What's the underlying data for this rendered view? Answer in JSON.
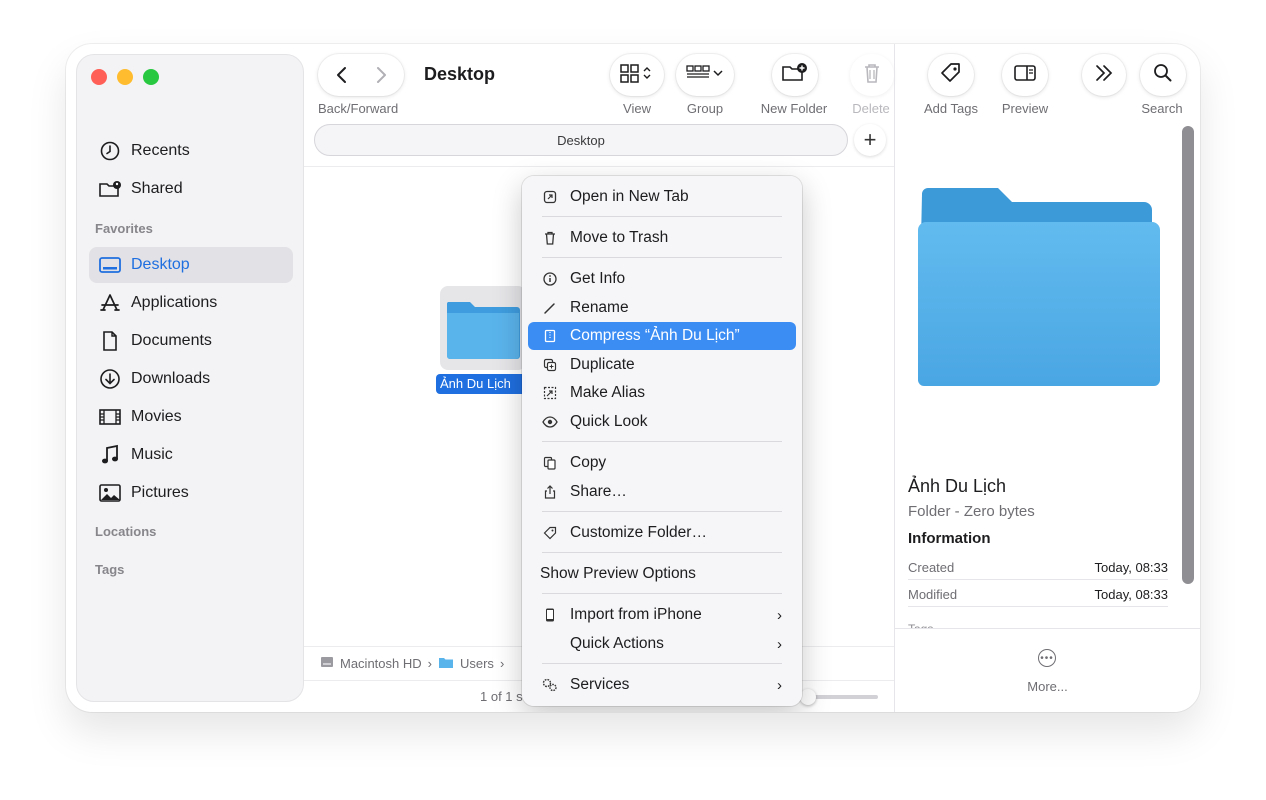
{
  "window": {
    "title": "Desktop"
  },
  "toolbar": {
    "back_forward_label": "Back/Forward",
    "view_label": "View",
    "group_label": "Group",
    "new_folder_label": "New Folder",
    "delete_label": "Delete",
    "add_tags_label": "Add Tags",
    "preview_label": "Preview",
    "search_label": "Search"
  },
  "pathbar": {
    "label": "Desktop"
  },
  "sidebar": {
    "top_items": [
      {
        "label": "Recents",
        "icon": "clock-icon"
      },
      {
        "label": "Shared",
        "icon": "shared-folder-icon"
      }
    ],
    "favorites_header": "Favorites",
    "favorites": [
      {
        "label": "Desktop",
        "icon": "desktop-icon",
        "active": true
      },
      {
        "label": "Applications",
        "icon": "applications-icon"
      },
      {
        "label": "Documents",
        "icon": "document-icon"
      },
      {
        "label": "Downloads",
        "icon": "download-icon"
      },
      {
        "label": "Movies",
        "icon": "film-icon"
      },
      {
        "label": "Music",
        "icon": "music-note-icon"
      },
      {
        "label": "Pictures",
        "icon": "photo-icon"
      }
    ],
    "locations_header": "Locations",
    "tags_header": "Tags"
  },
  "content": {
    "selected_file": "Ảnh Du Lịch",
    "breadcrumb": [
      "Macintosh HD",
      "Users"
    ],
    "status_text": "1 of 1 s"
  },
  "context_menu": {
    "items": [
      "Open in New Tab",
      "Move to Trash",
      "Get Info",
      "Rename",
      "Compress “Ảnh Du Lịch”",
      "Duplicate",
      "Make Alias",
      "Quick Look",
      "Copy",
      "Share…",
      "Customize Folder…",
      "Show Preview Options",
      "Import from iPhone",
      "Quick Actions",
      "Services"
    ],
    "highlighted": "Compress “Ảnh Du Lịch”"
  },
  "preview": {
    "name": "Ảnh Du Lịch",
    "kind": "Folder - Zero bytes",
    "information_header": "Information",
    "rows": [
      {
        "key": "Created",
        "value": "Today, 08:33"
      },
      {
        "key": "Modified",
        "value": "Today, 08:33"
      }
    ],
    "cut_row": "Tags",
    "more_label": "More..."
  },
  "colors": {
    "accent": "#1f6fe0",
    "highlight": "#3b8df4",
    "folder": "#5ab4ec"
  }
}
